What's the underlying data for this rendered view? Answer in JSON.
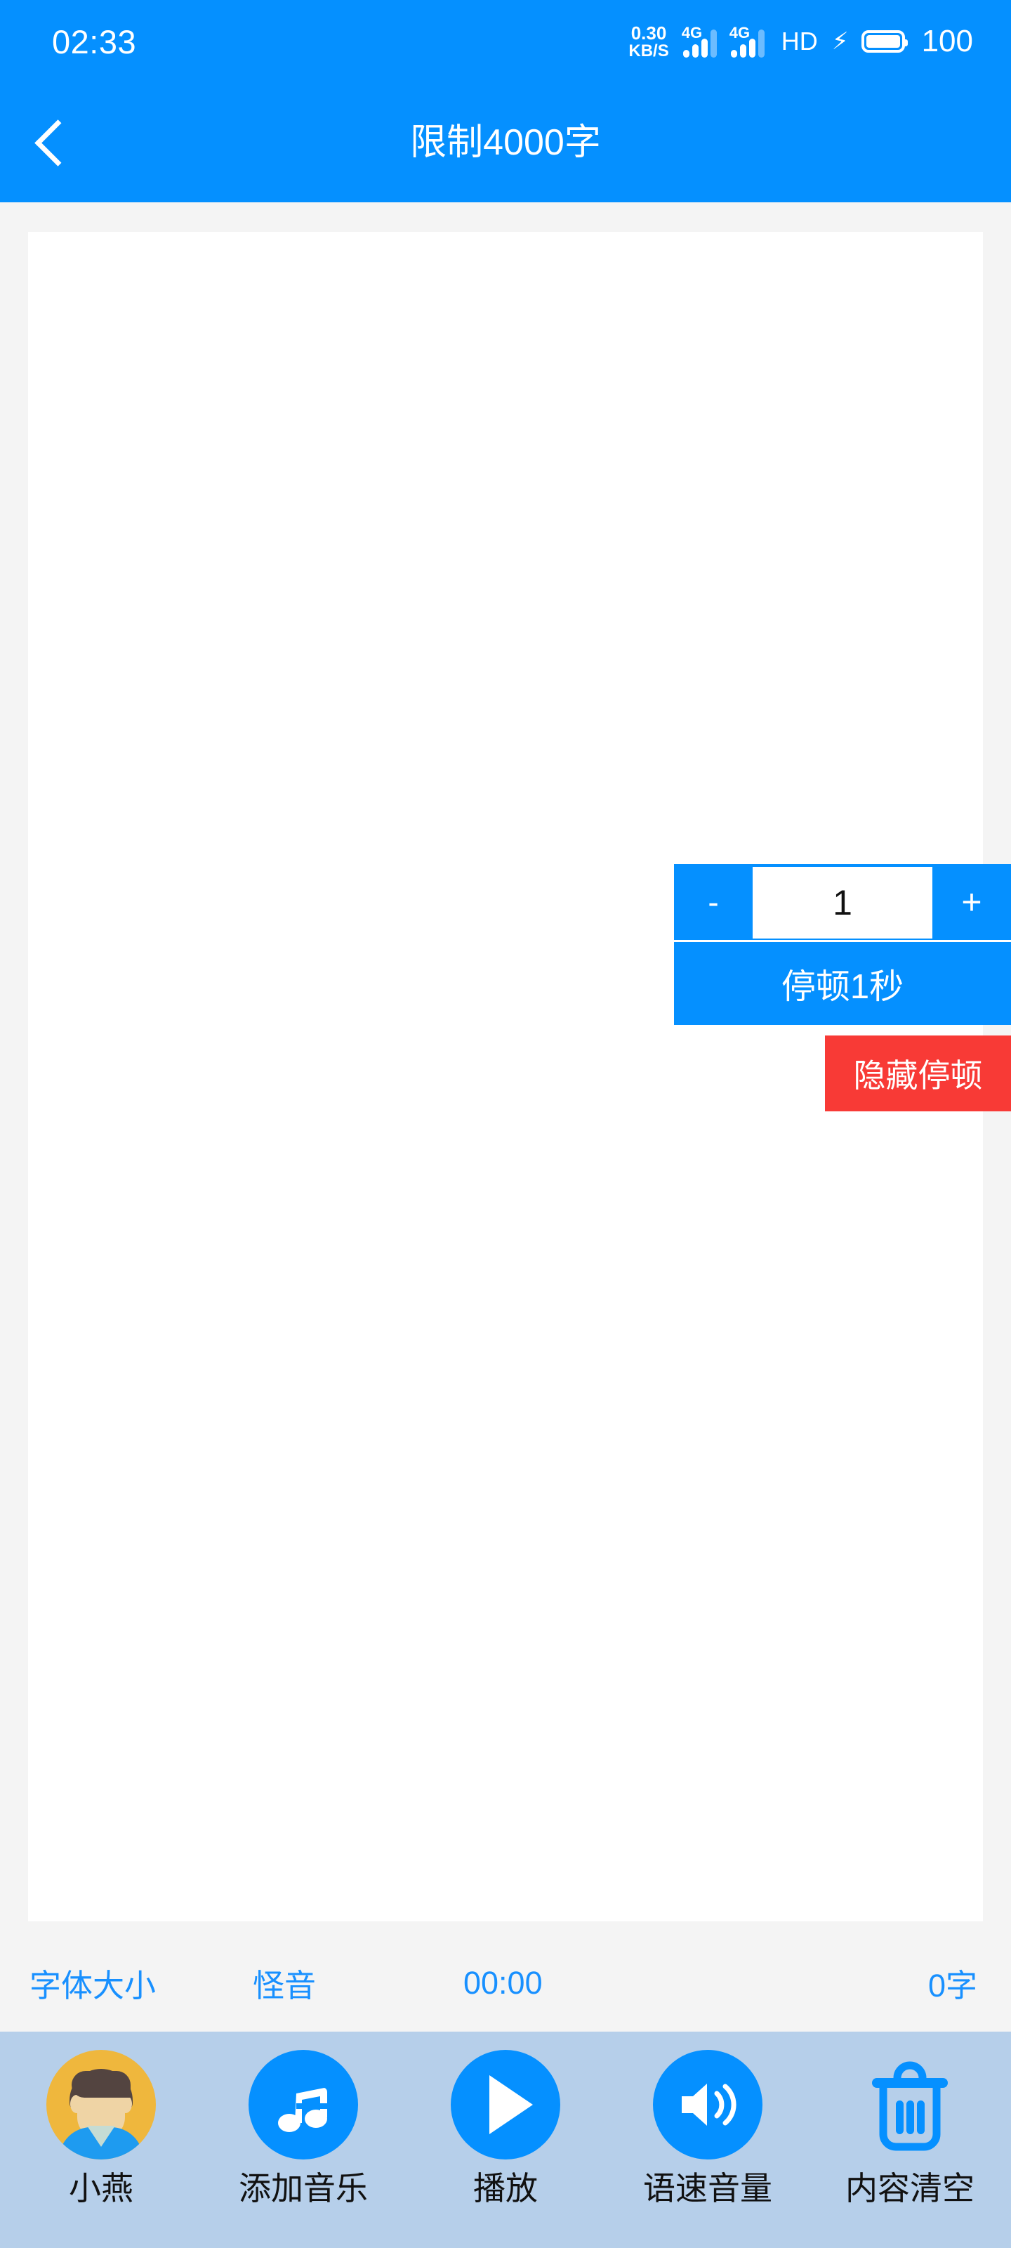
{
  "status_bar": {
    "time": "02:33",
    "net_speed_value": "0.30",
    "net_speed_unit": "KB/S",
    "signal_1_label": "4G",
    "signal_2_label": "4G",
    "hd_label": "HD",
    "charging_icon": "lightning-bolt-icon",
    "battery_percent": "100"
  },
  "title_bar": {
    "back_icon": "back-chevron-icon",
    "title": "限制4000字"
  },
  "editor": {
    "value": "",
    "placeholder": ""
  },
  "pause_widget": {
    "decrement_label": "-",
    "value": "1",
    "increment_label": "+",
    "action_label": "停顿1秒",
    "hide_label": "隐藏停顿",
    "accent_color": "#0590FF",
    "hide_color": "#F83A36"
  },
  "info_row": {
    "font_size_label": "字体大小",
    "voice_label": "怪音",
    "timer": "00:00",
    "char_count": "0字",
    "text_color": "#1890FF"
  },
  "toolbar": {
    "background_color": "#B6CFEA",
    "items": [
      {
        "label": "小燕",
        "icon": "user-avatar-icon"
      },
      {
        "label": "添加音乐",
        "icon": "music-note-icon"
      },
      {
        "label": "播放",
        "icon": "play-icon"
      },
      {
        "label": "语速音量",
        "icon": "speaker-volume-icon"
      },
      {
        "label": "内容清空",
        "icon": "trash-icon"
      }
    ]
  }
}
